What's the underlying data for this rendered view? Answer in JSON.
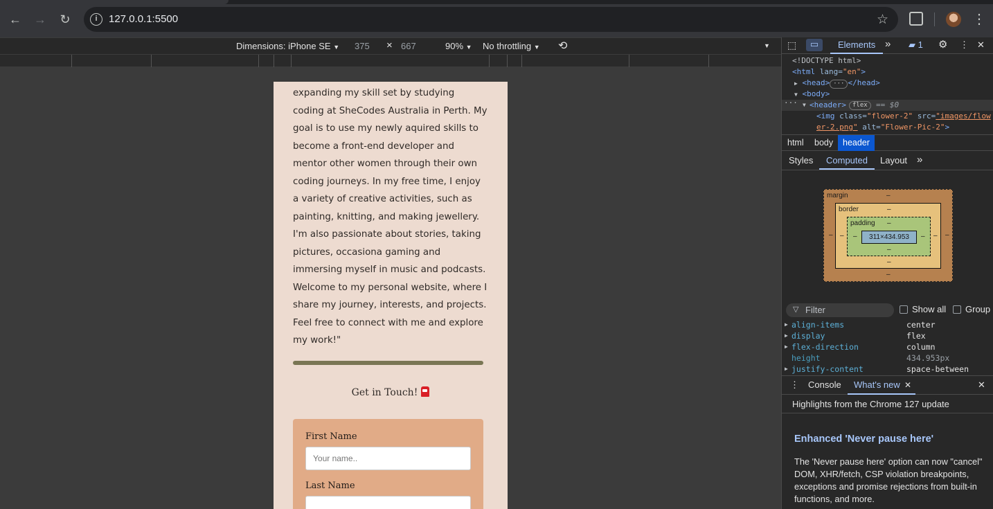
{
  "browser": {
    "url": "127.0.0.1:5500"
  },
  "device_toolbar": {
    "dimensions_label": "Dimensions: iPhone SE",
    "width": "375",
    "times": "×",
    "height": "667",
    "zoom": "90%",
    "throttling": "No throttling"
  },
  "page": {
    "about_text": "expanding my skill set by studying coding at SheCodes Australia in Perth. My goal is to use my newly aquired skills to become a front-end developer and mentor other women through their own coding journeys. In my free time, I enjoy a variety of creative activities, such as painting, knitting, and making jewellery. I'm also passionate about stories, taking pictures, occasiona gaming and immersing myself in music and podcasts. Welcome to my personal website, where I share my journey, interests, and projects. Feel free to connect with me and explore my work!\"",
    "contact_title": "Get in Touch!",
    "form": {
      "first_name_label": "First Name",
      "first_name_placeholder": "Your name..",
      "last_name_label": "Last Name"
    }
  },
  "devtools": {
    "tabs": {
      "elements": "Elements",
      "more": "»",
      "issues_count": "1"
    },
    "dom": {
      "doctype": "<!DOCTYPE html>",
      "html_open_tag": "<html",
      "lang_attr": "lang=",
      "lang_val": "\"en\"",
      "close_bracket": ">",
      "head_open": "<head>",
      "head_ellipsis": "···",
      "head_close": "</head>",
      "body_open": "<body>",
      "header_open": "<header>",
      "flex_pill": "flex",
      "selected_marker": "== $0",
      "img_tag": "<img",
      "class_attr": "class=",
      "class_val": "\"flower-2\"",
      "src_attr": "src=",
      "src_val_1": "\"images/flow",
      "src_val_2": "er-2.png\"",
      "alt_attr": "alt=",
      "alt_val": "\"Flower-Pic-2\"",
      "dots": "···"
    },
    "breadcrumbs": [
      "html",
      "body",
      "header"
    ],
    "subtabs": {
      "styles": "Styles",
      "computed": "Computed",
      "layout": "Layout",
      "more": "»"
    },
    "box_model": {
      "margin": "margin",
      "border": "border",
      "padding": "padding",
      "content": "311×434.953",
      "dash": "–"
    },
    "filter": {
      "placeholder": "Filter",
      "show_all": "Show all",
      "group": "Group"
    },
    "computed": [
      {
        "prop": "align-items",
        "value": "center"
      },
      {
        "prop": "display",
        "value": "flex"
      },
      {
        "prop": "flex-direction",
        "value": "column"
      },
      {
        "prop": "height",
        "value": "434.953px"
      },
      {
        "prop": "justify-content",
        "value": "space-between"
      }
    ],
    "drawer": {
      "console": "Console",
      "whats_new": "What's new",
      "highlights": "Highlights from the Chrome 127 update",
      "title": "Enhanced 'Never pause here'",
      "body": "The 'Never pause here' option can now \"cancel\" DOM, XHR/fetch, CSP violation breakpoints, exceptions and promise rejections from built-in functions, and more."
    }
  }
}
